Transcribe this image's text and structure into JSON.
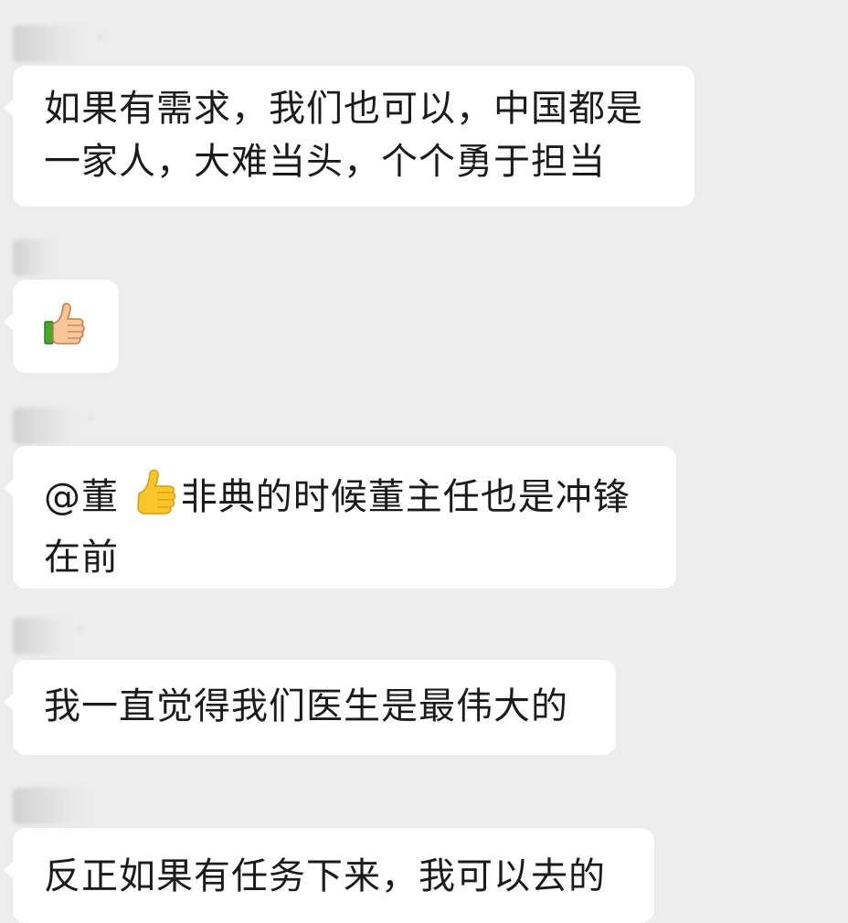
{
  "messages": [
    {
      "lines": [
        "如果有需求，我们也可以，中国都是",
        "一家人，大难当头，个个勇于担当"
      ]
    },
    {
      "emoji": "thumbs-up-icon"
    },
    {
      "prefix": "@董",
      "emoji": "thumbs-up-icon",
      "line1_rest": "非典的时候董主任也是冲锋",
      "line2": "在前"
    },
    {
      "lines": [
        "我一直觉得我们医生是最伟大的"
      ]
    },
    {
      "lines": [
        "反正如果有任务下来，我可以去的"
      ]
    }
  ]
}
